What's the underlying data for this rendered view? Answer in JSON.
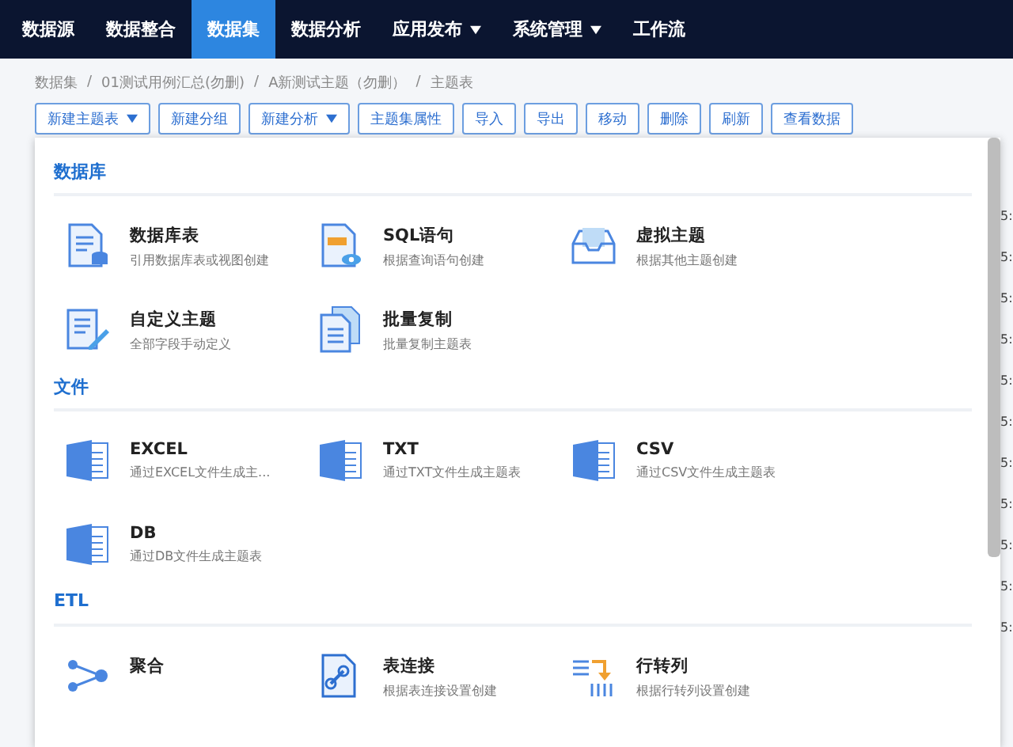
{
  "nav": [
    {
      "label": "数据源",
      "selected": false,
      "dropdown": false
    },
    {
      "label": "数据整合",
      "selected": false,
      "dropdown": false
    },
    {
      "label": "数据集",
      "selected": true,
      "dropdown": false
    },
    {
      "label": "数据分析",
      "selected": false,
      "dropdown": false
    },
    {
      "label": "应用发布",
      "selected": false,
      "dropdown": true
    },
    {
      "label": "系统管理",
      "selected": false,
      "dropdown": true
    },
    {
      "label": "工作流",
      "selected": false,
      "dropdown": false
    }
  ],
  "breadcrumb": {
    "separator": "/",
    "items": [
      "数据集",
      "01测试用例汇总(勿删)",
      "A新测试主题（勿删）",
      "主题表"
    ]
  },
  "toolbar": [
    {
      "label": "新建主题表",
      "dropdown": true
    },
    {
      "label": "新建分组",
      "dropdown": false
    },
    {
      "label": "新建分析",
      "dropdown": true
    },
    {
      "label": "主题集属性",
      "dropdown": false
    },
    {
      "label": "导入",
      "dropdown": false
    },
    {
      "label": "导出",
      "dropdown": false
    },
    {
      "label": "移动",
      "dropdown": false
    },
    {
      "label": "删除",
      "dropdown": false
    },
    {
      "label": "刷新",
      "dropdown": false
    },
    {
      "label": "查看数据",
      "dropdown": false
    }
  ],
  "background_table": {
    "cells": [
      "5:",
      "5:",
      "5:",
      "5:",
      "5:",
      "5:",
      "5:",
      "5:",
      "5:",
      "5:",
      "5:"
    ]
  },
  "menu": {
    "sections": [
      {
        "title": "数据库",
        "items": [
          {
            "kind": "db-table",
            "title": "数据库表",
            "subtitle": "引用数据库表或视图创建"
          },
          {
            "kind": "sql",
            "title": "SQL语句",
            "subtitle": "根据查询语句创建"
          },
          {
            "kind": "virtual",
            "title": "虚拟主题",
            "subtitle": "根据其他主题创建"
          },
          {
            "kind": "custom",
            "title": "自定义主题",
            "subtitle": "全部字段手动定义"
          },
          {
            "kind": "batch",
            "title": "批量复制",
            "subtitle": "批量复制主题表"
          }
        ]
      },
      {
        "title": "文件",
        "items": [
          {
            "kind": "file",
            "title": "EXCEL",
            "subtitle": "通过EXCEL文件生成主..."
          },
          {
            "kind": "file",
            "title": "TXT",
            "subtitle": "通过TXT文件生成主题表"
          },
          {
            "kind": "file",
            "title": "CSV",
            "subtitle": "通过CSV文件生成主题表"
          },
          {
            "kind": "file",
            "title": "DB",
            "subtitle": "通过DB文件生成主题表"
          }
        ]
      },
      {
        "title": "ETL",
        "items": [
          {
            "kind": "aggregate",
            "title": "聚合"
          },
          {
            "kind": "join",
            "title": "表连接",
            "subtitle": "根据表连接设置创建"
          },
          {
            "kind": "pivot",
            "title": "行转列",
            "subtitle": "根据行转列设置创建"
          }
        ]
      }
    ]
  }
}
